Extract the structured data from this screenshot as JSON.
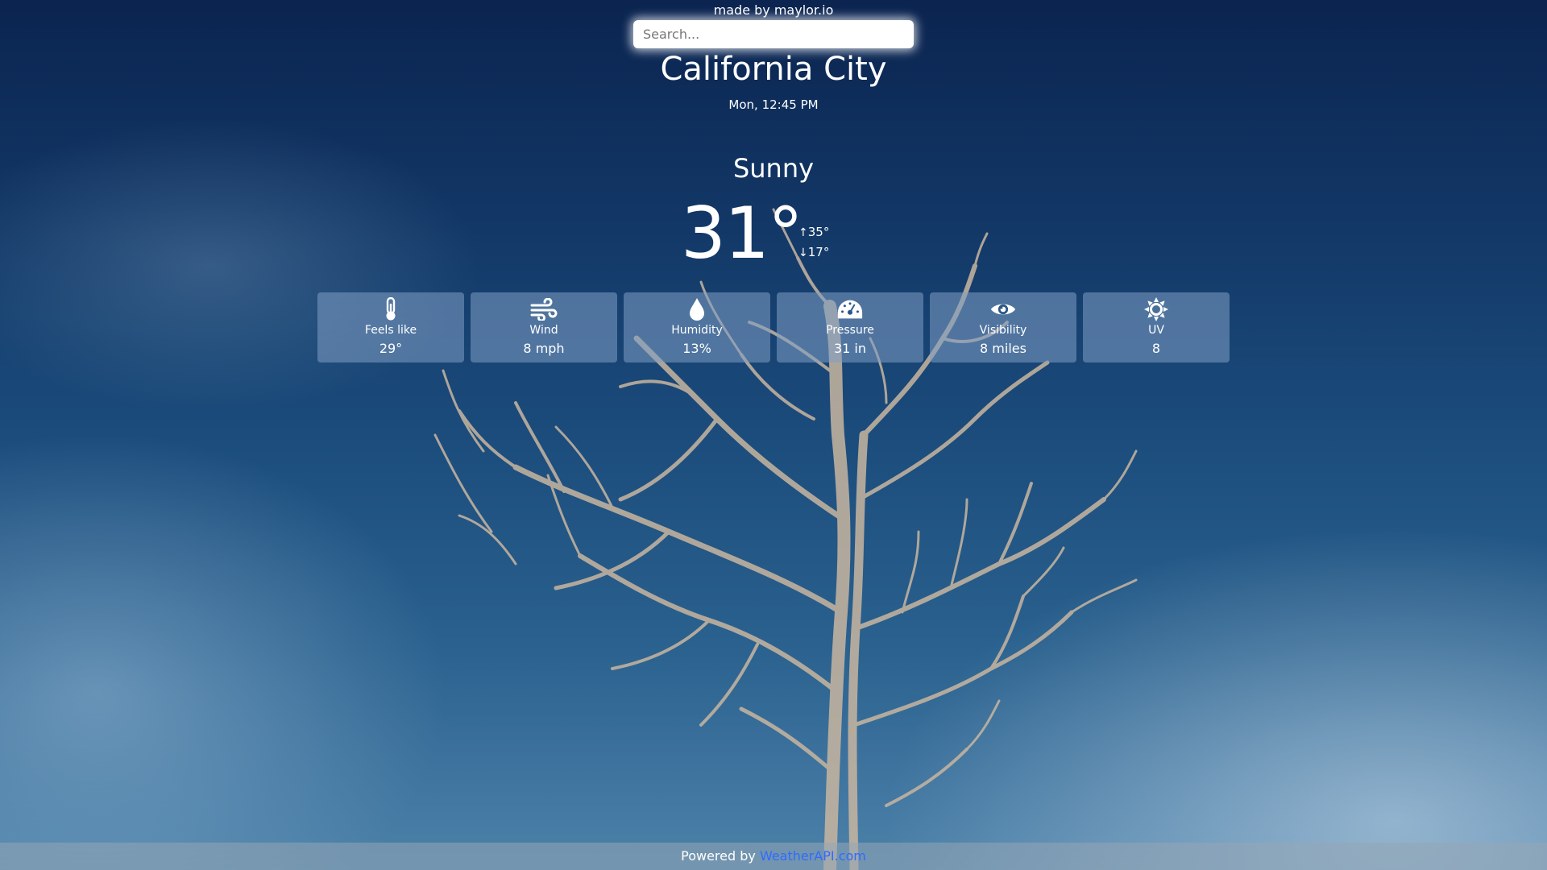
{
  "header": {
    "credit": "made by maylor.io"
  },
  "search": {
    "placeholder": "Search..."
  },
  "location": {
    "city": "California City",
    "datetime": "Mon, 12:45 PM"
  },
  "current": {
    "condition": "Sunny",
    "temperature": "31°",
    "high": "35°",
    "low": "17°",
    "high_arrow": "↑",
    "low_arrow": "↓"
  },
  "stats": [
    {
      "icon": "thermometer-icon",
      "label": "Feels like",
      "value": "29°"
    },
    {
      "icon": "wind-icon",
      "label": "Wind",
      "value": "8 mph"
    },
    {
      "icon": "droplet-icon",
      "label": "Humidity",
      "value": "13%"
    },
    {
      "icon": "gauge-icon",
      "label": "Pressure",
      "value": "31 in"
    },
    {
      "icon": "eye-icon",
      "label": "Visibility",
      "value": "8 miles"
    },
    {
      "icon": "sun-icon",
      "label": "UV",
      "value": "8"
    }
  ],
  "footer": {
    "prefix": "Powered by ",
    "link_text": "WeatherAPI.com"
  },
  "colors": {
    "link": "#2f6bff",
    "card_bg": "#809ec4",
    "sky_top": "#0b2450",
    "sky_bottom": "#4d82aa"
  }
}
